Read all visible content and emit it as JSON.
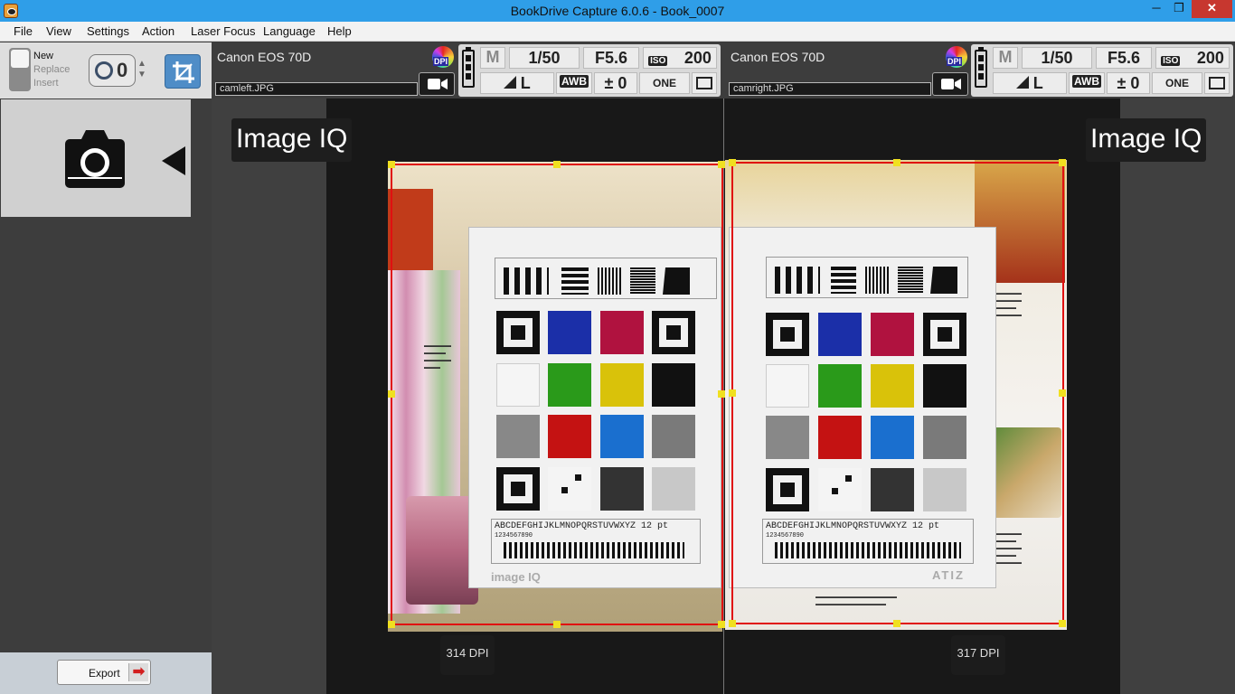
{
  "window": {
    "title": "BookDrive Capture 6.0.6 - Book_0007",
    "minimize": "─",
    "maximize": "❐",
    "close": "✕"
  },
  "menu": [
    "File",
    "View",
    "Settings",
    "Action",
    "Laser Focus",
    "Language",
    "Help"
  ],
  "toolbar": {
    "modes": [
      "New",
      "Replace",
      "Insert"
    ],
    "active_mode": "New",
    "timer_value": "0",
    "timer_arrows": "▲▼"
  },
  "export": {
    "label": "Export",
    "arrow": "➡"
  },
  "cameras": {
    "left": {
      "name": "Canon EOS 70D",
      "file": "camleft.JPG",
      "dpi_badge": "DPI",
      "mode": "M",
      "shutter": "1/50",
      "aperture": "F5.6",
      "iso_label": "ISO",
      "iso": "200",
      "quality": "L",
      "wb": "AWB",
      "exposure": "± 0",
      "drive": "ONE SHOT",
      "battery_level": 3
    },
    "right": {
      "name": "Canon EOS 70D",
      "file": "camright.JPG",
      "dpi_badge": "DPI",
      "mode": "M",
      "shutter": "1/50",
      "aperture": "F5.6",
      "iso_label": "ISO",
      "iso": "200",
      "quality": "L",
      "wb": "AWB",
      "exposure": "± 0",
      "drive": "ONE SHOT",
      "battery_level": 3
    }
  },
  "viewer": {
    "left": {
      "overlay": "Image IQ",
      "dpi": "314 DPI"
    },
    "right": {
      "overlay": "Image IQ",
      "dpi": "317 DPI"
    },
    "chart": {
      "alphabet": "ABCDEFGHIJKLMNOPQRSTUVWXYZ",
      "size": "12 pt",
      "digits": "1234567890",
      "logo_left": "image IQ",
      "logo_right": "ATIZ"
    }
  },
  "colors": {
    "titlebar": "#2f9ee8",
    "crop": "#e01010",
    "handles": "#f0e020",
    "swatches": [
      "#1b2fa8",
      "#b0123f",
      "#2a9a1a",
      "#d9c20a",
      "#111111",
      "#888888",
      "#c41212",
      "#1a6fcf"
    ]
  }
}
